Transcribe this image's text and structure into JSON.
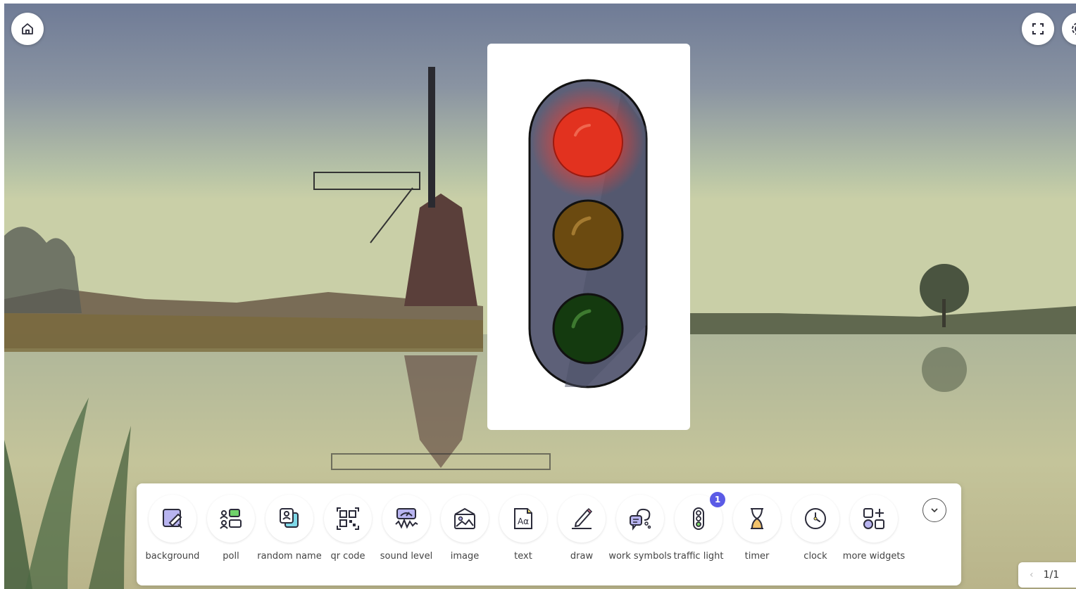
{
  "top_controls": {
    "home_icon": "home-icon",
    "fullscreen_icon": "fullscreen-icon",
    "settings_icon": "gear-icon"
  },
  "widget": {
    "type": "traffic-light",
    "active_light": "red",
    "colors": {
      "red": "#e2321f",
      "amber": "#6b4a10",
      "green": "#143a0f",
      "housing": "#5d6078"
    }
  },
  "toolbar": {
    "items": [
      {
        "label": "background",
        "icon": "background-icon"
      },
      {
        "label": "poll",
        "icon": "poll-icon"
      },
      {
        "label": "random name",
        "icon": "random-name-icon"
      },
      {
        "label": "qr code",
        "icon": "qr-code-icon"
      },
      {
        "label": "sound level",
        "icon": "sound-level-icon"
      },
      {
        "label": "image",
        "icon": "image-icon"
      },
      {
        "label": "text",
        "icon": "text-icon"
      },
      {
        "label": "draw",
        "icon": "draw-icon"
      },
      {
        "label": "work symbols",
        "icon": "work-symbols-icon"
      },
      {
        "label": "traffic light",
        "icon": "traffic-light-icon",
        "badge": "1"
      },
      {
        "label": "timer",
        "icon": "hourglass-icon"
      },
      {
        "label": "clock",
        "icon": "clock-icon"
      },
      {
        "label": "more widgets",
        "icon": "more-widgets-icon"
      }
    ],
    "collapse_icon": "chevron-down-icon"
  },
  "pager": {
    "label": "1/1",
    "prev_symbol": "‹"
  },
  "colors": {
    "accent": "#5b5be6",
    "icon_stroke": "#2b2b3a",
    "icon_fill": "#b8b4f0"
  }
}
